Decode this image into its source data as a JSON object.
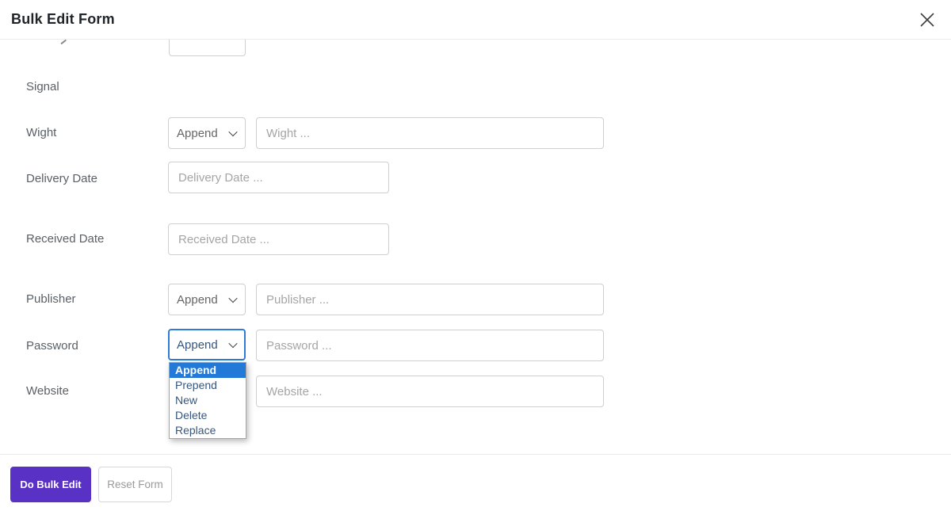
{
  "header": {
    "title": "Bulk Edit Form"
  },
  "form": {
    "signal_label": "Signal",
    "rows": [
      {
        "label": "Wight",
        "mode": "Append",
        "placeholder": "Wight ..."
      },
      {
        "label": "Delivery Date",
        "placeholder": "Delivery Date ..."
      },
      {
        "label": "Received Date",
        "placeholder": "Received Date ..."
      },
      {
        "label": "Publisher",
        "mode": "Append",
        "placeholder": "Publisher ..."
      },
      {
        "label": "Password",
        "mode": "Append",
        "placeholder": "Password ..."
      },
      {
        "label": "Website",
        "placeholder": "Website ..."
      }
    ],
    "mode_dropdown": {
      "selected": "Append",
      "options": [
        "Append",
        "Prepend",
        "New",
        "Delete",
        "Replace"
      ]
    }
  },
  "footer": {
    "submit_label": "Do Bulk Edit",
    "reset_label": "Reset Form"
  },
  "colors": {
    "accent_purple": "#5a31c5",
    "focus_blue": "#2e7cd6",
    "dropdown_highlight": "#2379d8"
  }
}
